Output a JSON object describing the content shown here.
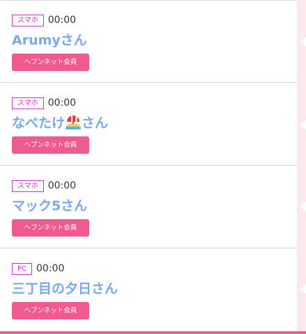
{
  "entries": [
    {
      "device": "スマホ",
      "time": "00:00",
      "name": "Arumyさん",
      "badge": "ヘブンネット会員"
    },
    {
      "device": "スマホ",
      "time": "00:00",
      "name_before": "なべたけ",
      "name_icon": "beach-umbrella-icon",
      "name_after": "さん",
      "badge": "ヘブンネット会員"
    },
    {
      "device": "スマホ",
      "time": "00:00",
      "name": "マック5さん",
      "badge": "ヘブンネット会員"
    },
    {
      "device": "PC",
      "time": "00:00",
      "name": "三丁目の夕日さん",
      "badge": "ヘブンネット会員"
    }
  ],
  "colors": {
    "name_text": "#7aa8ec",
    "device_badge": "#cc33cc",
    "member_badge": "#f05b8f",
    "side_panel": "#fde8ec"
  }
}
